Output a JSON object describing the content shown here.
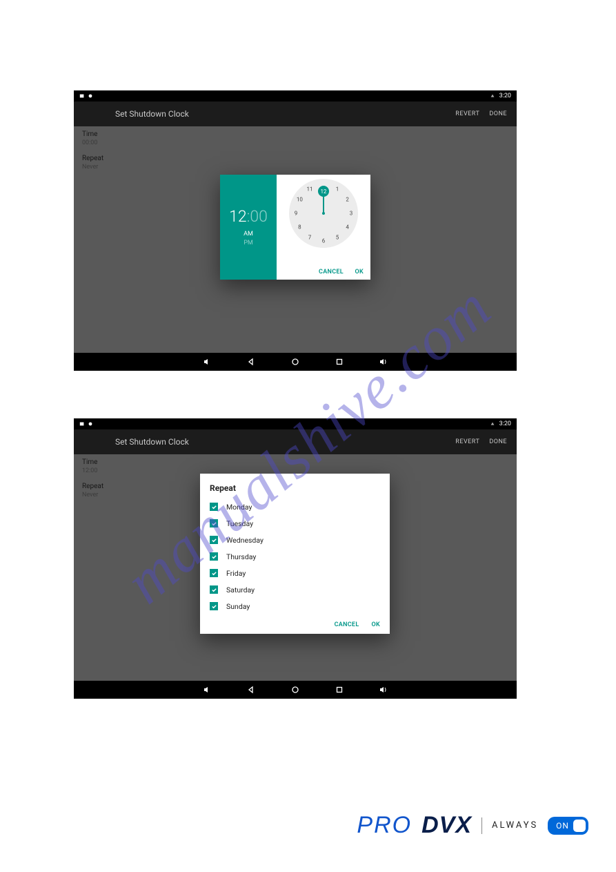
{
  "watermark": "manualshive.com",
  "status": {
    "time": "3:20"
  },
  "appbar": {
    "title": "Set Shutdown Clock",
    "revert": "REVERT",
    "done": "DONE"
  },
  "screen1": {
    "list": {
      "time_label": "Time",
      "time_value": "00:00",
      "repeat_label": "Repeat",
      "repeat_value": "Never"
    },
    "timepicker": {
      "hour": "12",
      "sep": ":",
      "minute": "00",
      "am": "AM",
      "pm": "PM",
      "selected_hour": "12",
      "cancel": "CANCEL",
      "ok": "OK",
      "hours": [
        "12",
        "1",
        "2",
        "3",
        "4",
        "5",
        "6",
        "7",
        "8",
        "9",
        "10",
        "11"
      ]
    }
  },
  "screen2": {
    "list": {
      "time_label": "Time",
      "time_value": "12:00",
      "repeat_label": "Repeat",
      "repeat_value": "Never"
    },
    "repeat": {
      "title": "Repeat",
      "days": [
        "Monday",
        "Tuesday",
        "Wednesday",
        "Thursday",
        "Friday",
        "Saturday",
        "Sunday"
      ],
      "cancel": "CANCEL",
      "ok": "OK"
    }
  },
  "footer": {
    "pro": "PRO",
    "dvx": "DVX",
    "always": "ALWAYS",
    "on": "ON"
  }
}
